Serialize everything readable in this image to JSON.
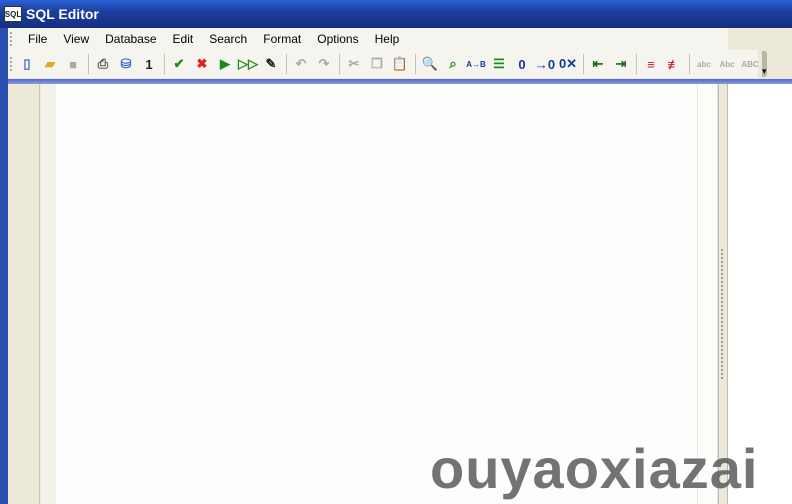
{
  "window": {
    "title": "SQL Editor",
    "icon_text": "SQL"
  },
  "menu": [
    {
      "label": "File"
    },
    {
      "label": "View"
    },
    {
      "label": "Database"
    },
    {
      "label": "Edit"
    },
    {
      "label": "Search"
    },
    {
      "label": "Format"
    },
    {
      "label": "Options"
    },
    {
      "label": "Help"
    }
  ],
  "toolbar": [
    {
      "name": "new-icon",
      "glyph": "▯",
      "color": "#3a6fc9"
    },
    {
      "name": "open-icon",
      "glyph": "▰",
      "color": "#e4a72a"
    },
    {
      "name": "save-icon",
      "glyph": "■",
      "color": "#aaaaaa"
    },
    "sep",
    {
      "name": "print-icon",
      "glyph": "⎙",
      "color": "#555"
    },
    {
      "name": "database-icon",
      "glyph": "⛁",
      "color": "#3a6fc9"
    },
    {
      "name": "numbering-icon",
      "glyph": "1",
      "color": "#222"
    },
    "sep",
    {
      "name": "commit-icon",
      "glyph": "✔",
      "color": "#1a8c1a"
    },
    {
      "name": "rollback-icon",
      "glyph": "✖",
      "color": "#e02020"
    },
    {
      "name": "execute-grid-icon",
      "glyph": "▶",
      "color": "#1a8c1a"
    },
    {
      "name": "execute-all-icon",
      "glyph": "▷▷",
      "color": "#1a8c1a"
    },
    {
      "name": "explain-icon",
      "glyph": "✎",
      "color": "#222"
    },
    "sep",
    {
      "name": "undo-icon",
      "glyph": "↶",
      "color": "#aaa"
    },
    {
      "name": "redo-icon",
      "glyph": "↷",
      "color": "#aaa"
    },
    "sep",
    {
      "name": "cut-icon",
      "glyph": "✂",
      "color": "#aaa"
    },
    {
      "name": "copy-icon",
      "glyph": "❐",
      "color": "#aaa"
    },
    {
      "name": "paste-icon",
      "glyph": "📋",
      "color": "#aaa"
    },
    "sep",
    {
      "name": "find-icon",
      "glyph": "🔍",
      "color": "#3a6fc9"
    },
    {
      "name": "find-next-icon",
      "glyph": "⌕",
      "color": "#1a8c1a"
    },
    {
      "name": "replace-icon",
      "glyph": "A→B",
      "color": "#123a9e"
    },
    {
      "name": "goto-line-icon",
      "glyph": "☰",
      "color": "#1a8c1a"
    },
    {
      "name": "bookmark-icon",
      "glyph": "0",
      "color": "#123a9e"
    },
    {
      "name": "next-bookmark-icon",
      "glyph": "→0",
      "color": "#123a9e"
    },
    {
      "name": "clear-bookmark-icon",
      "glyph": "0✕",
      "color": "#123a9e"
    },
    "sep",
    {
      "name": "indent-icon",
      "glyph": "⇤",
      "color": "#1a6a1a"
    },
    {
      "name": "outdent-icon",
      "glyph": "⇥",
      "color": "#1a6a1a"
    },
    "sep",
    {
      "name": "comment-icon",
      "glyph": "≡",
      "color": "#c02020"
    },
    {
      "name": "uncomment-icon",
      "glyph": "≢",
      "color": "#c02020"
    },
    "sep",
    {
      "name": "lowercase-icon",
      "glyph": "abc",
      "color": "#aaa"
    },
    {
      "name": "capitalize-icon",
      "glyph": "Abc",
      "color": "#aaa"
    },
    {
      "name": "uppercase-icon",
      "glyph": "ABC",
      "color": "#aaa"
    }
  ],
  "watermark": "ouyaoxiazai"
}
